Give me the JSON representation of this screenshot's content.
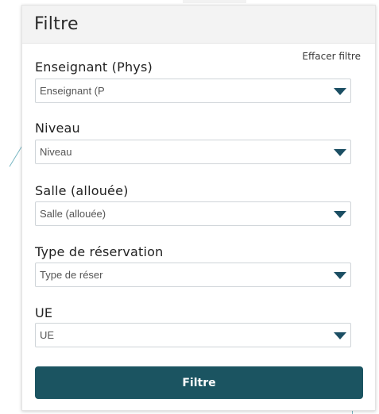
{
  "panel": {
    "title": "Filtre",
    "clear_label": "Effacer filtre",
    "submit_label": "Filtre"
  },
  "fields": [
    {
      "label": "Enseignant (Phys)",
      "value": "Enseignant (P"
    },
    {
      "label": "Niveau",
      "value": "Niveau"
    },
    {
      "label": "Salle (allouée)",
      "value": "Salle (allouée)"
    },
    {
      "label": "Type de réservation",
      "value": "Type de réser"
    },
    {
      "label": "UE",
      "value": "UE"
    }
  ],
  "colors": {
    "accent": "#1b5461",
    "caret": "#1b4e63",
    "header_bg": "#f3f3f3"
  }
}
